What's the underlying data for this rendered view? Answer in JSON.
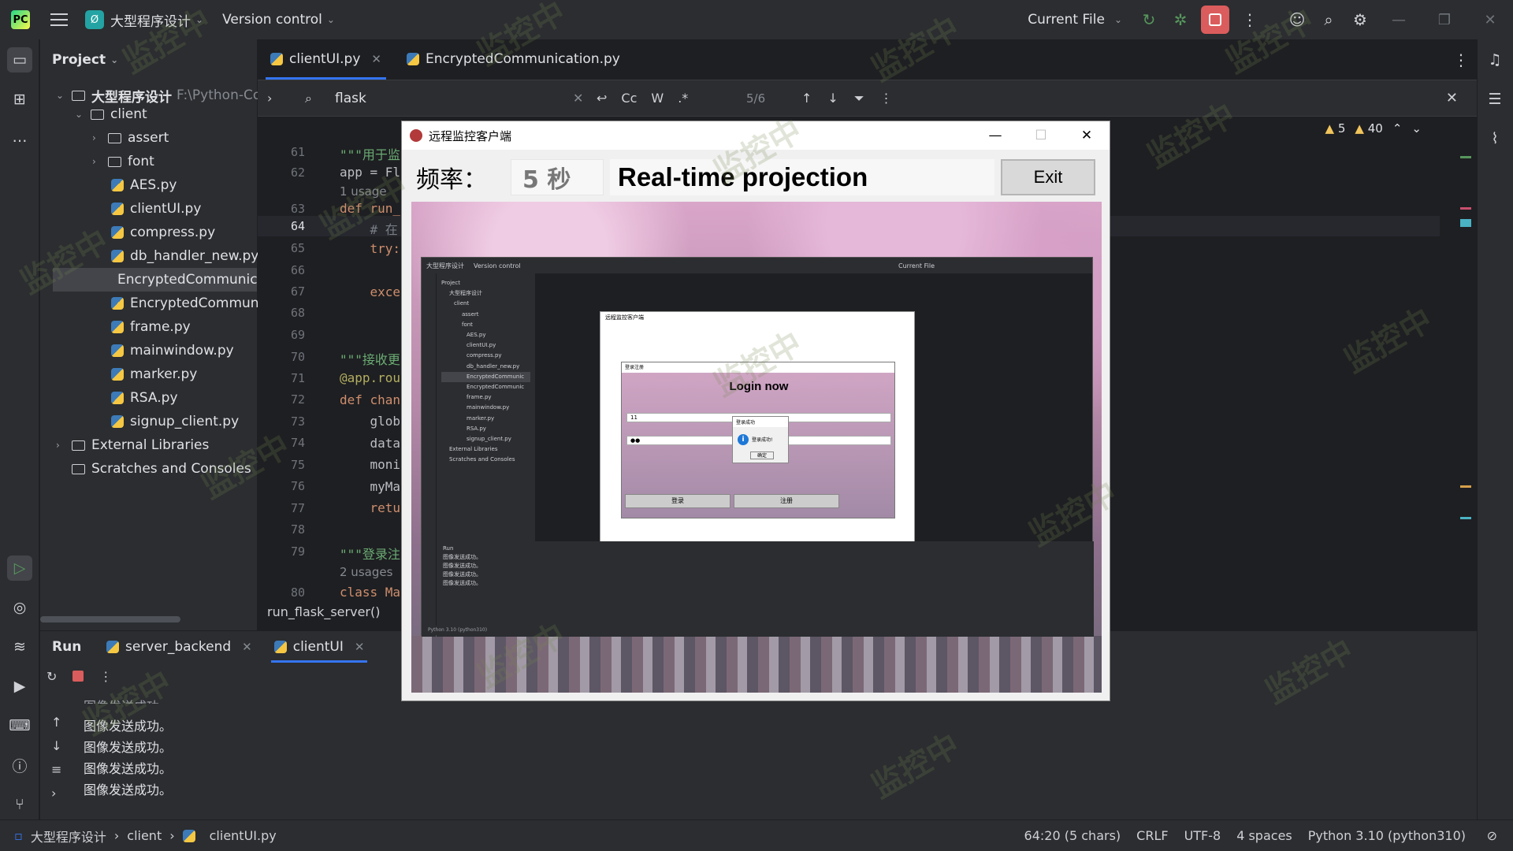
{
  "titlebar": {
    "project_name": "大型程序设计",
    "project_badge": "Ø",
    "vcs": "Version control",
    "run_config": "Current File"
  },
  "project_panel": {
    "title": "Project",
    "root": "大型程序设计",
    "root_path": "F:\\Python-Co",
    "items": [
      {
        "label": "client",
        "kind": "folder"
      },
      {
        "label": "assert",
        "kind": "folder"
      },
      {
        "label": "font",
        "kind": "folder"
      },
      {
        "label": "AES.py",
        "kind": "py"
      },
      {
        "label": "clientUI.py",
        "kind": "py"
      },
      {
        "label": "compress.py",
        "kind": "py"
      },
      {
        "label": "db_handler_new.py",
        "kind": "py"
      },
      {
        "label": "EncryptedCommunic",
        "kind": "py"
      },
      {
        "label": "EncryptedCommunic",
        "kind": "py"
      },
      {
        "label": "frame.py",
        "kind": "py"
      },
      {
        "label": "mainwindow.py",
        "kind": "py"
      },
      {
        "label": "marker.py",
        "kind": "py"
      },
      {
        "label": "RSA.py",
        "kind": "py"
      },
      {
        "label": "signup_client.py",
        "kind": "py"
      }
    ],
    "external": "External Libraries",
    "scratches": "Scratches and Consoles"
  },
  "editor": {
    "tabs": [
      {
        "label": "clientUI.py"
      },
      {
        "label": "EncryptedCommunication.py"
      }
    ],
    "search": {
      "query": "flask",
      "match": "5/6",
      "opt_case": "Cc",
      "opt_word": "W",
      "opt_regex": ".*"
    },
    "inspections": {
      "warnings": "5",
      "weak_warnings": "40"
    },
    "line_numbers": [
      "61",
      "62",
      "",
      "63",
      "64",
      "65",
      "66",
      "67",
      "68",
      "69",
      "70",
      "71",
      "72",
      "73",
      "74",
      "75",
      "76",
      "77",
      "78",
      "79",
      "",
      "80"
    ],
    "code": {
      "l61": "\"\"\"用于监",
      "l62": "app = Fl",
      "hint1": "1 usage",
      "l63": "def run_",
      "l64": "    # 在",
      "l65": "    try:",
      "l67": "    exce",
      "l70": "\"\"\"接收更",
      "l71": "@app.rou",
      "l72": "def chan",
      "l73": "    glob",
      "l74": "    data",
      "l75": "    moni",
      "l76": "    myMa",
      "l77": "    retu",
      "l79": "\"\"\"登录注",
      "hint2": "2 usages",
      "l80": "class Ma"
    },
    "breadcrumb": "run_flask_server()"
  },
  "run_panel": {
    "title": "Run",
    "tabs": [
      {
        "label": "server_backend"
      },
      {
        "label": "clientUI"
      }
    ],
    "lines": [
      "图像发送成功。",
      "图像发送成功。",
      "图像发送成功。",
      "图像发送成功。",
      "图像发送成功。"
    ]
  },
  "statusbar": {
    "crumbs": [
      "大型程序设计",
      "client",
      "clientUI.py"
    ],
    "position": "64:20 (5 chars)",
    "line_ending": "CRLF",
    "encoding": "UTF-8",
    "indent": "4 spaces",
    "interpreter": "Python 3.10 (python310)"
  },
  "tk_window": {
    "title": "远程监控客户端",
    "freq_label": "频率：",
    "freq_value": "5 秒",
    "heading": "Real-time projection",
    "exit": "Exit"
  },
  "mini_window": {
    "title": "远程监控客户端",
    "login_window": "登录注册",
    "login_title": "Login now",
    "username": "11",
    "password": "●●",
    "msg_title": "登录成功",
    "msg_text": "登录成功!",
    "msg_ok": "确定",
    "btn_login": "登录",
    "btn_signup": "注册"
  },
  "watermark": "监控中"
}
